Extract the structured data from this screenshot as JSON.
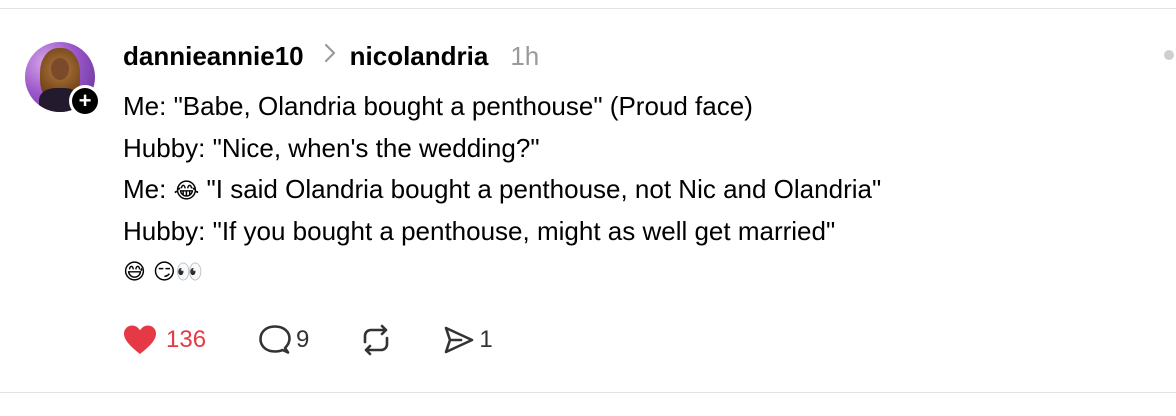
{
  "post": {
    "author": "dannieannie10",
    "recipient": "nicolandria",
    "time": "1h",
    "lines": [
      "Me: \"Babe, Olandria bought a penthouse\" (Proud face)",
      "Hubby: \"Nice, when's the wedding?\"",
      "Hubby: \"If you bought a penthouse, might as well get married\""
    ],
    "line3_prefix": "Me: ",
    "line3_emoji": "😂",
    "line3_text": " \"I said Olandria bought a penthouse, not Nic and Olandria\"",
    "emoji_line": "😅 😏👀",
    "icons": {
      "avatar": "profile-avatar",
      "follow": "plus-icon",
      "separator": "chevron-right-icon",
      "like": "heart-icon",
      "reply": "comment-icon",
      "repost": "repost-icon",
      "share": "send-icon"
    }
  },
  "actions": {
    "likes": "136",
    "replies": "9",
    "shares": "1"
  },
  "colors": {
    "like": "#e63946",
    "muted": "#9a9a9a",
    "text": "#000000"
  }
}
